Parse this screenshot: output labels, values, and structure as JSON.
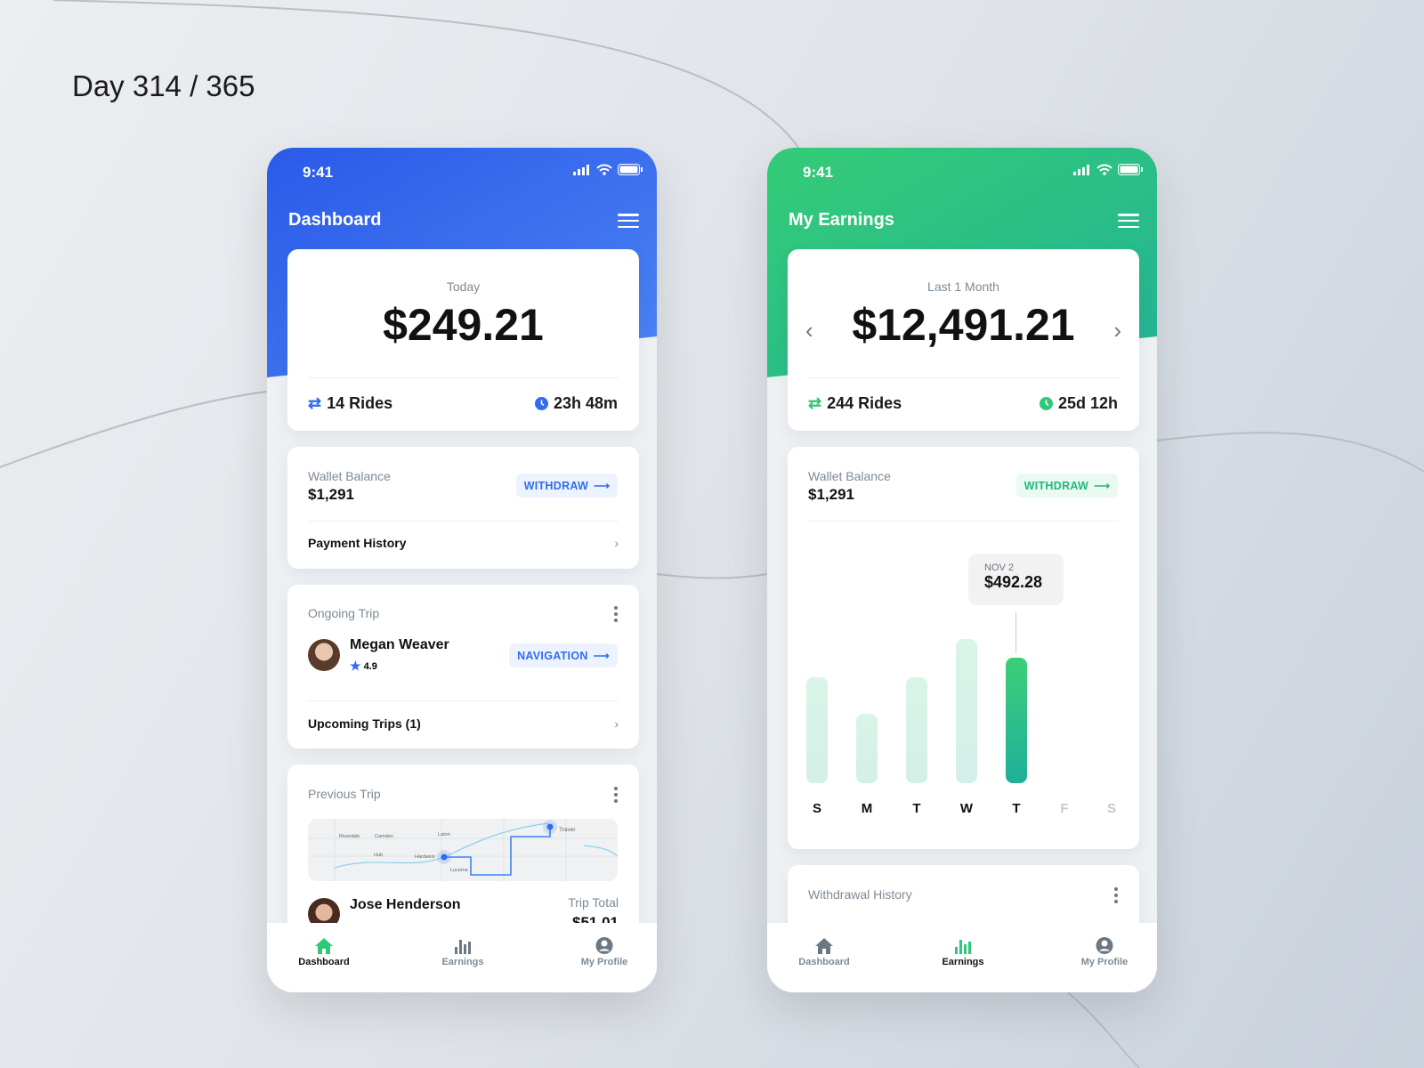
{
  "page_label": "Day 314 / 365",
  "colors": {
    "blue": "#2f63ea",
    "green": "#2fc77a",
    "teal": "#20b095"
  },
  "dashboard": {
    "time": "9:41",
    "title": "Dashboard",
    "today_label": "Today",
    "today_amount": "$249.21",
    "rides": "14 Rides",
    "duration": "23h 48m",
    "wallet_label": "Wallet Balance",
    "wallet_amount": "$1,291",
    "withdraw": "WITHDRAW",
    "payment_history": "Payment History",
    "ongoing_label": "Ongoing Trip",
    "rider_name": "Megan Weaver",
    "rider_rating": "4.9",
    "navigation": "NAVIGATION",
    "upcoming": "Upcoming Trips (1)",
    "previous_label": "Previous Trip",
    "map_labels": [
      "Riverdale",
      "Camden",
      "Laton",
      "Hub",
      "Hardwick",
      "Lucerne",
      "Traver"
    ],
    "prev_rider": "Jose Henderson",
    "trip_total_label": "Trip Total",
    "trip_total": "$51.01"
  },
  "earnings": {
    "time": "9:41",
    "title": "My Earnings",
    "period_label": "Last 1 Month",
    "amount": "$12,491.21",
    "rides": "244 Rides",
    "duration": "25d 12h",
    "wallet_label": "Wallet Balance",
    "wallet_amount": "$1,291",
    "withdraw": "WITHDRAW",
    "tooltip_date": "NOV 2",
    "tooltip_value": "$492.28",
    "withdrawal_history": "Withdrawal History"
  },
  "nav": {
    "items": [
      "Dashboard",
      "Earnings",
      "My Profile"
    ]
  },
  "chart_data": {
    "type": "bar",
    "categories": [
      "S",
      "M",
      "T",
      "W",
      "T",
      "F",
      "S"
    ],
    "values": [
      414,
      271,
      414,
      567,
      492.28,
      null,
      null
    ],
    "highlighted_index": 4,
    "tooltip": {
      "date": "NOV 2",
      "value": "$492.28"
    },
    "grid": false
  }
}
